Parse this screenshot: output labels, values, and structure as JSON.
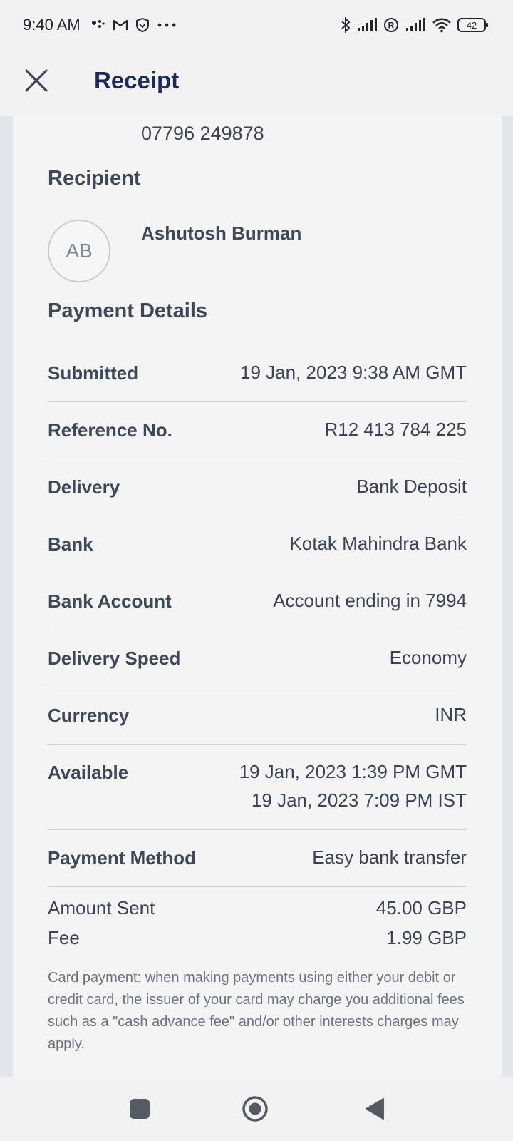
{
  "status_bar": {
    "time": "9:40 AM",
    "battery": "42"
  },
  "header": {
    "title": "Receipt"
  },
  "sender": {
    "phone": "07796 249878"
  },
  "recipient": {
    "section_title": "Recipient",
    "initials": "AB",
    "name": "Ashutosh Burman"
  },
  "payment_details": {
    "section_title": "Payment Details",
    "rows": [
      {
        "label": "Submitted",
        "value": "19 Jan, 2023 9:38 AM GMT"
      },
      {
        "label": "Reference No.",
        "value": "R12 413 784 225"
      },
      {
        "label": "Delivery",
        "value": "Bank Deposit"
      },
      {
        "label": "Bank",
        "value": "Kotak Mahindra Bank"
      },
      {
        "label": "Bank Account",
        "value": "Account ending in 7994"
      },
      {
        "label": "Delivery Speed",
        "value": "Economy"
      },
      {
        "label": "Currency",
        "value": "INR"
      },
      {
        "label": "Available",
        "value": "19 Jan, 2023 1:39 PM GMT",
        "value2": "19 Jan, 2023 7:09 PM IST"
      },
      {
        "label": "Payment Method",
        "value": "Easy bank transfer"
      }
    ]
  },
  "amounts": {
    "sent_label": "Amount Sent",
    "sent_value": "45.00 GBP",
    "fee_label": "Fee",
    "fee_value": "1.99 GBP"
  },
  "disclaimer": "Card payment: when making payments using either your debit or credit card, the issuer of your card may charge you additional fees such as a \"cash advance fee\" and/or other interests charges may apply.",
  "colors": {
    "title": "#1b2a5c",
    "text": "#3a4454",
    "divider": "#cfd4da"
  }
}
